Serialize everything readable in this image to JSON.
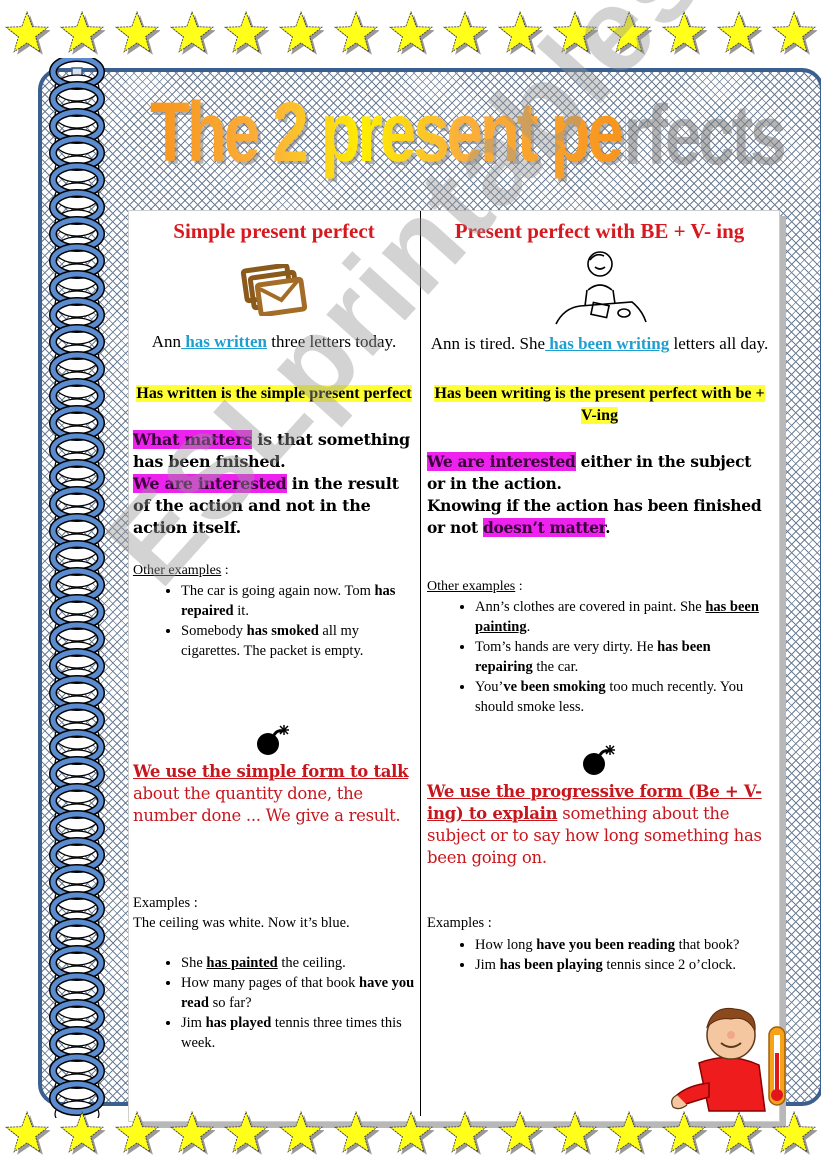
{
  "title": "The 2 present perfects",
  "watermark": "ESLprintables.com",
  "left": {
    "heading": "Simple present perfect",
    "icon": "envelopes-icon",
    "sentence": {
      "pre": "Ann",
      "verb": " has written",
      "post": " three letters today."
    },
    "definition": "Has written is the simple present perfect",
    "rule": {
      "hl1": "What matters",
      "t1": " is that something has been fnished.",
      "hl2": "We are interested",
      "t2": " in the result of the action and not in the action itself."
    },
    "other_label": "Other examples",
    "other_colon": " :",
    "other_examples": [
      {
        "a": "The car is going again now. Tom ",
        "b": "has repaired",
        "c": " it."
      },
      {
        "a": "Somebody ",
        "b": "has smoked",
        "c": " all my cigarettes. The packet is empty."
      }
    ],
    "note_icon": "bomb-icon",
    "note": {
      "lead": "We use the simple form to talk",
      "rest": " about the quantity done, the number done ... We give a result."
    },
    "examples_label": "Examples :",
    "examples_intro": "The ceiling was white. Now it’s blue.",
    "examples": [
      {
        "a": "She ",
        "b": "has painted",
        "c": " the ceiling.",
        "underline": true
      },
      {
        "a": "How many pages of that book ",
        "b": "have you read",
        "c": " so far?",
        "underline": false
      },
      {
        "a": "Jim ",
        "b": "has played",
        "c": " tennis three times this week.",
        "underline": false
      }
    ]
  },
  "right": {
    "heading": "Present perfect with BE + V- ing",
    "icon": "girl-writing-icon",
    "sentence": {
      "pre": "Ann is tired. She",
      "verb": " has been writing",
      "post": " letters all day."
    },
    "definition": "Has been writing is the present perfect with be + V-ing",
    "rule": {
      "hl1": "We are interested",
      "t1": " either in the subject or in the action.",
      "t2": "Knowing if the action has been finished or not ",
      "hl2": "doesn’t matter",
      "t3": "."
    },
    "other_label": "Other examples",
    "other_colon": " :",
    "other_examples": [
      {
        "a": "Ann’s clothes are covered in paint. She ",
        "b": "has been painting",
        "c": ".",
        "underline": true
      },
      {
        "a": "Tom’s hands are very dirty. He ",
        "b": "has been repairing",
        "c": " the car.",
        "underline": false
      },
      {
        "a": "You’",
        "b": "ve been smoking",
        "c": " too much recently. You should smoke less.",
        "underline": false
      }
    ],
    "note_icon": "bomb-icon",
    "note": {
      "lead": "We use the progressive  form (Be + V-ing) to explain",
      "rest": "  something about the subject or to say how long something has been going on."
    },
    "examples_label": "Examples :",
    "examples": [
      {
        "a": "How long ",
        "b": "have you been reading",
        "c": " that book?"
      },
      {
        "a": "Jim ",
        "b": "has been playing",
        "c": " tennis since 2 o’clock."
      }
    ]
  },
  "colors": {
    "heading_red": "#d7191f",
    "verb_blue": "#1e9fcf",
    "highlight_yellow": "#ffff33",
    "highlight_pink": "#ee22ee",
    "frame_blue": "#3b5f8e",
    "star_yellow": "#ffff1a"
  }
}
